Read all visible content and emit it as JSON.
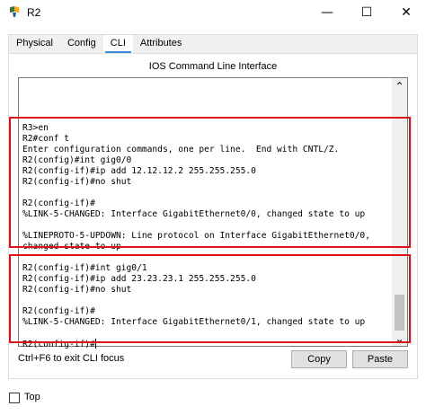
{
  "window": {
    "title": "R2",
    "minimize_glyph": "—",
    "maximize_glyph": "☐",
    "close_glyph": "✕"
  },
  "tabs": [
    {
      "label": "Physical",
      "active": false
    },
    {
      "label": "Config",
      "active": false
    },
    {
      "label": "CLI",
      "active": true
    },
    {
      "label": "Attributes",
      "active": false
    }
  ],
  "cli": {
    "header": "IOS Command Line Interface",
    "lines": [
      "R3>en",
      "R2#conf t",
      "Enter configuration commands, one per line.  End with CNTL/Z.",
      "R2(config)#int gig0/0",
      "R2(config-if)#ip add 12.12.12.2 255.255.255.0",
      "R2(config-if)#no shut",
      "",
      "R2(config-if)#",
      "%LINK-5-CHANGED: Interface GigabitEthernet0/0, changed state to up",
      "",
      "%LINEPROTO-5-UPDOWN: Line protocol on Interface GigabitEthernet0/0,",
      "changed state to up",
      "",
      "R2(config-if)#int gig0/1",
      "R2(config-if)#ip add 23.23.23.1 255.255.255.0",
      "R2(config-if)#no shut",
      "",
      "R2(config-if)#",
      "%LINK-5-CHANGED: Interface GigabitEthernet0/1, changed state to up",
      ""
    ],
    "prompt": "R2(config-if)#",
    "scroll_up_glyph": "⌃",
    "scroll_down_glyph": "⌄"
  },
  "footer": {
    "hint": "Ctrl+F6 to exit CLI focus",
    "copy_label": "Copy",
    "paste_label": "Paste"
  },
  "bottom": {
    "top_label": "Top",
    "top_checked": false
  },
  "colors": {
    "highlight_box": "#e0101a",
    "active_tab_underline": "#3c8dd8"
  }
}
